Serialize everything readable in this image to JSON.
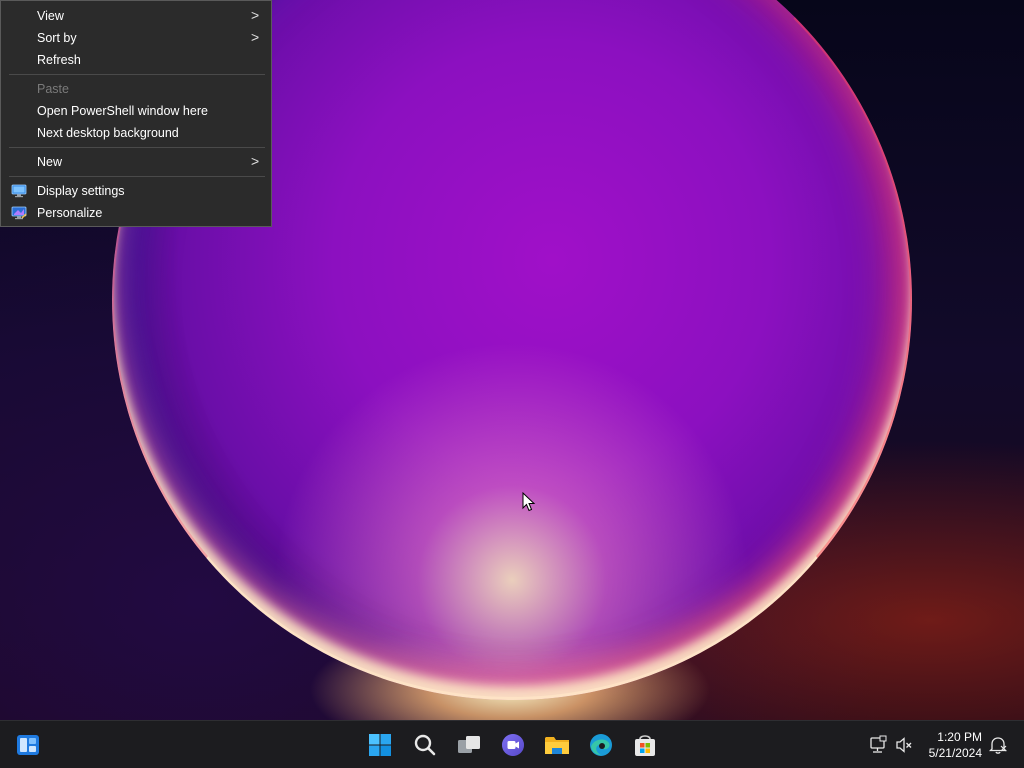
{
  "context_menu": {
    "items": [
      {
        "label": "View",
        "submenu": true
      },
      {
        "label": "Sort by",
        "submenu": true
      },
      {
        "label": "Refresh",
        "submenu": false
      },
      {
        "label": "Paste",
        "submenu": false,
        "disabled": true
      },
      {
        "label": "Open PowerShell window here",
        "submenu": false
      },
      {
        "label": "Next desktop background",
        "submenu": false
      },
      {
        "label": "New",
        "submenu": true
      },
      {
        "label": "Display settings",
        "icon": "display-settings-icon"
      },
      {
        "label": "Personalize",
        "icon": "personalize-icon"
      }
    ],
    "chevron": ">"
  },
  "taskbar": {
    "widgets_icon": "widgets-icon",
    "apps": [
      {
        "name": "start",
        "icon": "windows-start-icon"
      },
      {
        "name": "search",
        "icon": "search-icon"
      },
      {
        "name": "task-view",
        "icon": "task-view-icon"
      },
      {
        "name": "chat",
        "icon": "teams-chat-icon"
      },
      {
        "name": "file-explorer",
        "icon": "folder-icon"
      },
      {
        "name": "edge",
        "icon": "edge-browser-icon"
      },
      {
        "name": "store",
        "icon": "microsoft-store-icon"
      }
    ],
    "tray": {
      "network_icon": "network-icon",
      "volume_icon": "volume-muted-icon",
      "time": "1:20 PM",
      "date": "5/21/2024",
      "notification_icon": "notifications-icon"
    }
  },
  "colors": {
    "menu_bg": "#2b2b2b",
    "taskbar_bg": "#1c1c1f",
    "accent": "#0078d4"
  }
}
